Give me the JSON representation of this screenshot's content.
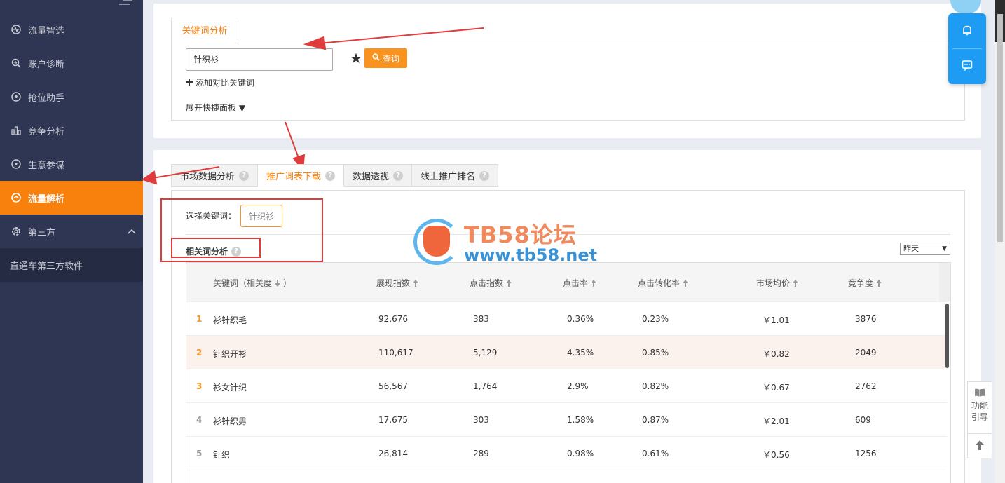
{
  "sidebar": {
    "items": [
      {
        "label": "流量智选",
        "icon": "pulse-icon"
      },
      {
        "label": "账户诊断",
        "icon": "diagnose-icon"
      },
      {
        "label": "抢位助手",
        "icon": "target-icon"
      },
      {
        "label": "竞争分析",
        "icon": "bar-chart-icon"
      },
      {
        "label": "生意参谋",
        "icon": "compass-icon"
      },
      {
        "label": "流量解析",
        "icon": "flow-icon"
      },
      {
        "label": "第三方",
        "icon": "gear-icon"
      }
    ],
    "sub_item": "直通车第三方软件"
  },
  "keyword_panel": {
    "tab_label": "关键词分析",
    "input_value": "针织衫",
    "query_label": "查询",
    "add_compare_label": "添加对比关键词",
    "expand_label": "展开快捷面板"
  },
  "tabs": [
    {
      "label": "市场数据分析",
      "active": false
    },
    {
      "label": "推广词表下载",
      "active": true
    },
    {
      "label": "数据透视",
      "active": false
    },
    {
      "label": "线上推广排名",
      "active": false
    }
  ],
  "content": {
    "select_label": "选择关键词：",
    "selected_keyword": "针织衫",
    "related_title": "相关词分析",
    "date_option": "昨天"
  },
  "table": {
    "headers": [
      "关键词（相关度",
      "）",
      "展现指数",
      "点击指数",
      "点击率",
      "点击转化率",
      "市场均价",
      "竞争度"
    ],
    "rows": [
      {
        "rank": "1",
        "keyword": "衫针织毛",
        "impressions": "92,676",
        "clicks": "383",
        "ctr": "0.36%",
        "cvr": "0.23%",
        "price": "￥1.01",
        "competition": "3876"
      },
      {
        "rank": "2",
        "keyword": "针织开衫",
        "impressions": "110,617",
        "clicks": "5,129",
        "ctr": "4.35%",
        "cvr": "0.85%",
        "price": "￥0.82",
        "competition": "2049"
      },
      {
        "rank": "3",
        "keyword": "衫女针织",
        "impressions": "56,567",
        "clicks": "1,764",
        "ctr": "2.9%",
        "cvr": "0.82%",
        "price": "￥0.67",
        "competition": "2762"
      },
      {
        "rank": "4",
        "keyword": "衫针织男",
        "impressions": "17,675",
        "clicks": "303",
        "ctr": "1.58%",
        "cvr": "0.87%",
        "price": "￥2.01",
        "competition": "609"
      },
      {
        "rank": "5",
        "keyword": "针织",
        "impressions": "26,814",
        "clicks": "289",
        "ctr": "0.98%",
        "cvr": "0.61%",
        "price": "￥0.56",
        "competition": "1256"
      }
    ]
  },
  "float": {
    "bell_icon": "bell-icon",
    "chat_icon": "chat-icon",
    "guide_label_1": "功能",
    "guide_label_2": "引导"
  },
  "watermark": {
    "title": "TB58论坛",
    "url": "www.tb58.net"
  },
  "colors": {
    "sidebar_bg": "#2f3653",
    "accent": "#f7810c",
    "annotation": "#e03c3c",
    "float_blue": "#1e9cf3"
  }
}
